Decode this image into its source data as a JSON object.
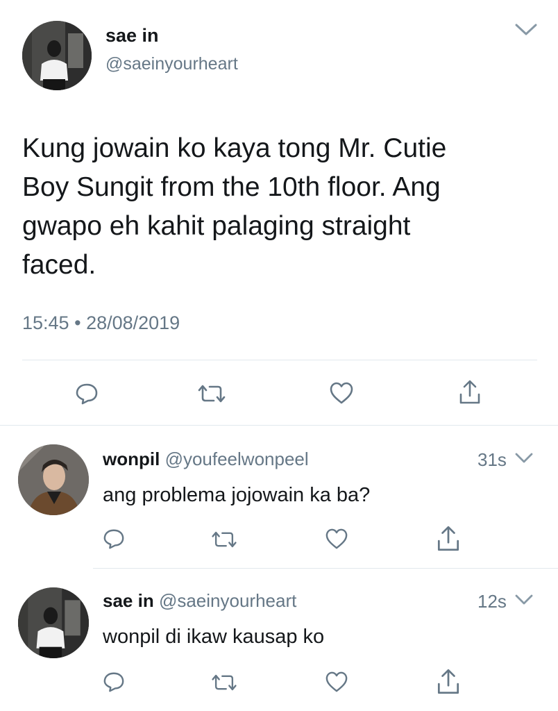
{
  "main_tweet": {
    "author_name": "sae in",
    "author_handle": "@saeinyourheart",
    "text_lines": [
      "Kung jowain ko kaya tong Mr. Cutie",
      "Boy Sungit from the 10th floor. Ang",
      "gwapo eh kahit palaging straight",
      "faced."
    ],
    "time": "15:45",
    "separator": "•",
    "date": "28/08/2019"
  },
  "replies": [
    {
      "author_name": "wonpil",
      "author_handle": "@youfeelwonpeel",
      "time_ago": "31s",
      "text": "ang problema jojowain ka ba?"
    },
    {
      "author_name": "sae in",
      "author_handle": "@saeinyourheart",
      "time_ago": "12s",
      "text": "wonpil di ikaw kausap ko"
    }
  ],
  "icons": {
    "chevron": "chevron-down-icon",
    "reply": "reply-icon",
    "retweet": "retweet-icon",
    "like": "heart-icon",
    "share": "share-icon"
  },
  "colors": {
    "text": "#14171a",
    "muted": "#657786",
    "divider": "#e1e8ed"
  }
}
